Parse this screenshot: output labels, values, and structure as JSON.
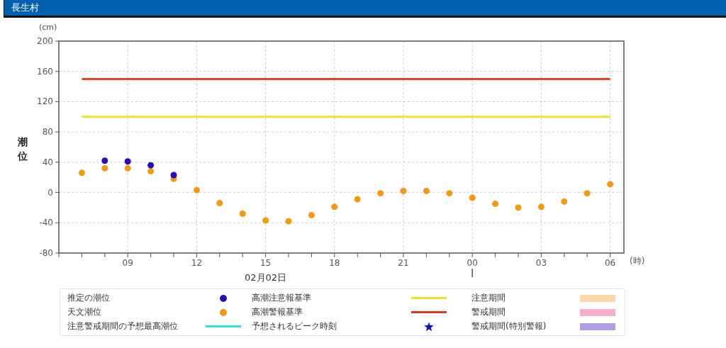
{
  "header": {
    "title": "長生村"
  },
  "chart": {
    "y_unit": "(cm)",
    "x_unit": "(時)",
    "date_label": "02月02日",
    "chart_data": {
      "type": "scatter",
      "ylabel": "潮位",
      "ylim": [
        -80,
        200
      ],
      "yticks": [
        -80,
        -40,
        0,
        40,
        80,
        120,
        160,
        200
      ],
      "grid": true,
      "categories": [
        null,
        null,
        "09",
        null,
        null,
        "12",
        null,
        null,
        "15",
        null,
        null,
        "18",
        null,
        null,
        "21",
        null,
        null,
        "00",
        null,
        null,
        "03",
        null,
        null,
        "06"
      ],
      "series": [
        {
          "type": "line",
          "color": "#e8411c",
          "values": [
            150,
            150,
            150,
            150,
            150,
            150,
            150,
            150,
            150,
            150,
            150,
            150,
            150,
            150,
            150,
            150,
            150,
            150,
            150,
            150,
            150,
            150,
            150,
            150
          ]
        },
        {
          "type": "line",
          "color": "#ece22a",
          "values": [
            100,
            100,
            100,
            100,
            100,
            100,
            100,
            100,
            100,
            100,
            100,
            100,
            100,
            100,
            100,
            100,
            100,
            100,
            100,
            100,
            100,
            100,
            100,
            100
          ]
        },
        {
          "color": "#f39a12",
          "values": [
            26,
            32,
            32,
            28,
            18,
            3,
            -14,
            -28,
            -37,
            -38,
            -30,
            -19,
            -9,
            -1,
            2,
            2,
            -1,
            -7,
            -15,
            -20,
            -19,
            -12,
            -1,
            11
          ]
        },
        {
          "color": "#2a0db4",
          "values": [
            null,
            42,
            41,
            36,
            23,
            null,
            null,
            null,
            null,
            null,
            null,
            null,
            null,
            null,
            null,
            null,
            null,
            null,
            null,
            null,
            null,
            null,
            null,
            null
          ]
        }
      ]
    }
  },
  "legend": [
    {
      "label": "推定の潮位",
      "kind": "dot",
      "color": "#2a0db4"
    },
    {
      "label": "高潮注意報基準",
      "kind": "line",
      "color": "#ece22a"
    },
    {
      "label": "注意期間",
      "kind": "swatch",
      "color": "#fad7a8"
    },
    {
      "label": "天文潮位",
      "kind": "dot",
      "color": "#f39a12"
    },
    {
      "label": "高潮警報基準",
      "kind": "line",
      "color": "#d63a22"
    },
    {
      "label": "警戒期間",
      "kind": "swatch",
      "color": "#f6aecb"
    },
    {
      "label": "注意警戒期間の予想最高潮位",
      "kind": "line",
      "color": "#2fe0e8"
    },
    {
      "label": "予想されるピーク時刻",
      "kind": "star",
      "color": "#1010d0"
    },
    {
      "label": "警戒期間(特別警報)",
      "kind": "swatch",
      "color": "#b49ae0"
    }
  ]
}
